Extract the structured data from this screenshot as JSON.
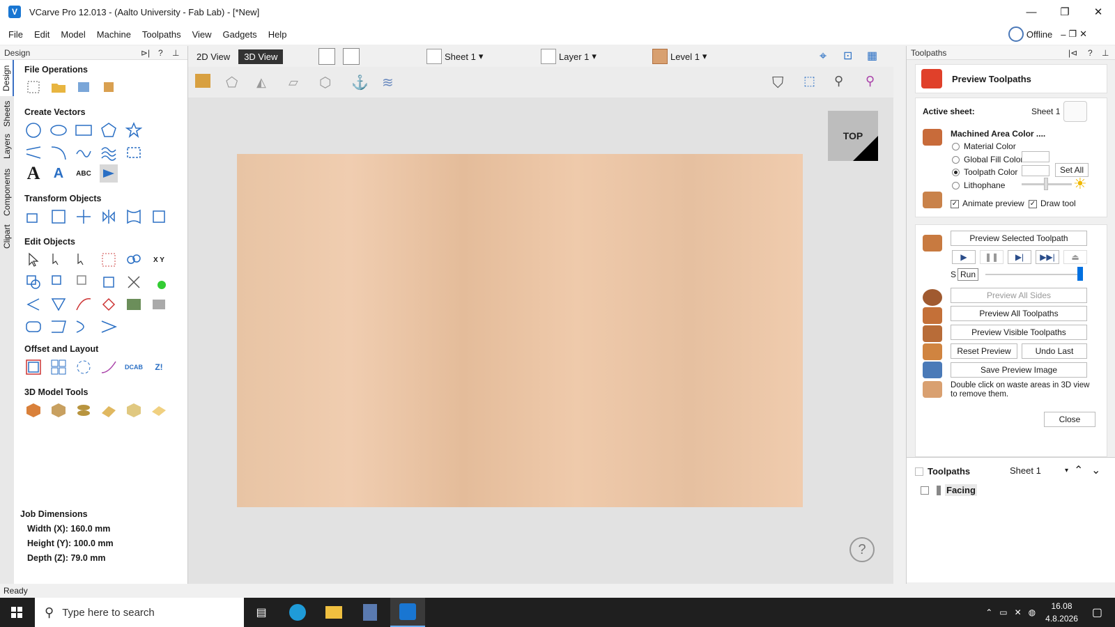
{
  "window": {
    "title": "VCarve Pro 12.013 - (Aalto University - Fab Lab) - [*New]",
    "minimize": "—",
    "restore": "❐",
    "close": "✕"
  },
  "menu": [
    "File",
    "Edit",
    "Model",
    "Machine",
    "Toolpaths",
    "View",
    "Gadgets",
    "Help"
  ],
  "offline": "Offline",
  "left_panel": {
    "title": "Design",
    "tabs": [
      "Design",
      "Sheets",
      "Layers",
      "Components",
      "Clipart"
    ],
    "sections": {
      "file_ops": "File Operations",
      "create_vectors": "Create Vectors",
      "transform": "Transform Objects",
      "edit": "Edit Objects",
      "offset": "Offset and Layout",
      "model3d": "3D Model Tools"
    },
    "job": {
      "title": "Job Dimensions",
      "width": "Width  (X): 160.0 mm",
      "height": "Height (Y): 100.0 mm",
      "depth": "Depth  (Z): 79.0 mm"
    }
  },
  "viewport": {
    "view2d": "2D View",
    "view3d": "3D View",
    "sheet": "Sheet 1",
    "layer": "Layer 1",
    "level": "Level 1",
    "cube_label": "TOP",
    "help": "?"
  },
  "right_panel": {
    "title": "Toolpaths",
    "preview_title": "Preview Toolpaths",
    "active_sheet_label": "Active sheet:",
    "active_sheet_value": "Sheet 1",
    "machined_color": "Machined Area Color ....",
    "options": [
      "Material Color",
      "Global Fill Color",
      "Toolpath Color",
      "Lithophane"
    ],
    "set_all": "Set All",
    "animate": "Animate preview",
    "draw_tool": "Draw tool",
    "preview_selected": "Preview Selected Toolpath",
    "speed_label": "S",
    "tooltip": "Run",
    "preview_all_sides": "Preview All Sides",
    "preview_all": "Preview All Toolpaths",
    "preview_visible": "Preview Visible Toolpaths",
    "reset": "Reset Preview",
    "undo": "Undo Last",
    "save_image": "Save Preview Image",
    "hint": "Double click on waste areas in 3D view to remove them.",
    "close": "Close",
    "list_title": "Toolpaths",
    "list_sheet": "Sheet 1",
    "items": [
      "Facing"
    ]
  },
  "status": "Ready",
  "taskbar": {
    "search": "Type here to search",
    "time": "16.08",
    "date": "4.8.2026"
  }
}
